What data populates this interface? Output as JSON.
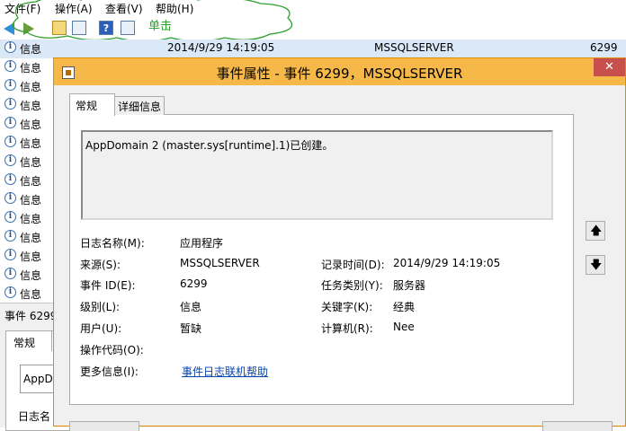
{
  "menu": [
    "文件(F)",
    "操作(A)",
    "查看(V)",
    "帮助(H)"
  ],
  "annotation": "单击",
  "events": {
    "columns_visible_row": {
      "level": "信息",
      "date": "2014/9/29 14:19:05",
      "source": "MSSQLSERVER",
      "id": "6299"
    },
    "other_rows_level": [
      "信息",
      "信息",
      "信息",
      "信息",
      "信息",
      "信息",
      "信息",
      "信息",
      "信息",
      "信息",
      "信息",
      "信息",
      "信息",
      "信息"
    ]
  },
  "bottom_pane": {
    "title": "事件 6299",
    "tab": "常规",
    "desc_fragment": "AppD",
    "log_label_fragment": "日志名"
  },
  "dialog": {
    "title": "事件属性 - 事件 6299，MSSQLSERVER",
    "close": "✕",
    "tabs": [
      "常规",
      "详细信息"
    ],
    "description": "AppDomain 2 (master.sys[runtime].1)已创建。",
    "fields": {
      "log_name_label": "日志名称(M):",
      "log_name": "应用程序",
      "source_label": "来源(S):",
      "source": "MSSQLSERVER",
      "logged_label": "记录时间(D):",
      "logged": "2014/9/29 14:19:05",
      "event_id_label": "事件 ID(E):",
      "event_id": "6299",
      "task_label": "任务类别(Y):",
      "task": "服务器",
      "level_label": "级别(L):",
      "level": "信息",
      "keywords_label": "关键字(K):",
      "keywords": "经典",
      "user_label": "用户(U):",
      "user": "暂缺",
      "computer_label": "计算机(R):",
      "computer": "Nee",
      "opcode_label": "操作代码(O):",
      "opcode": "",
      "more_info_label": "更多信息(I):",
      "more_info_link": "事件日志联机帮助"
    },
    "up_arrow": "🡅",
    "down_arrow": "🡇"
  }
}
